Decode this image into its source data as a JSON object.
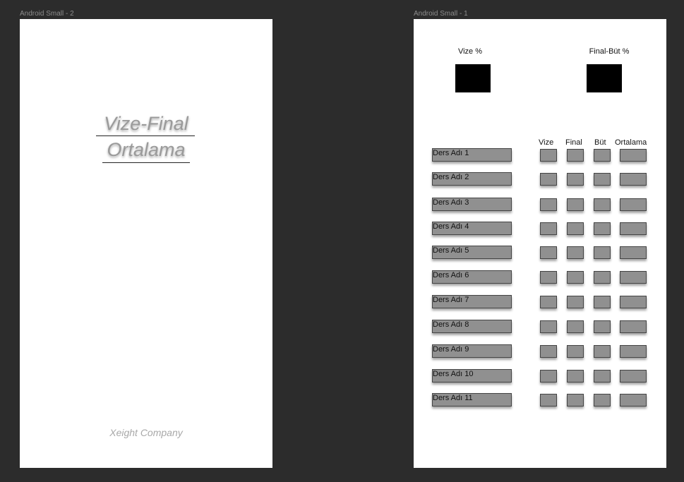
{
  "frames": {
    "splash": {
      "label": "Android Small - 2",
      "title_line1": "Vize-Final",
      "title_line2": "Ortalama",
      "company": "Xeight Company"
    },
    "main": {
      "label": "Android Small - 1",
      "vize_pct_label": "Vize %",
      "final_pct_label": "Final-Büt %",
      "columns": [
        "Vize",
        "Final",
        "Büt",
        "Ortalama"
      ],
      "courses": [
        "Ders Adı 1",
        "Ders Adı 2",
        "Ders Adı 3",
        "Ders Adı 4",
        "Ders Adı 5",
        "Ders Adı 6",
        "Ders Adı 7",
        "Ders Adı 8",
        "Ders Adı 9",
        "Ders Adı 10",
        "Ders Adı 11"
      ]
    }
  },
  "colors": {
    "canvas": "#2c2c2c",
    "frame": "#ffffff",
    "field": "#909090",
    "pct_box": "#000000"
  }
}
